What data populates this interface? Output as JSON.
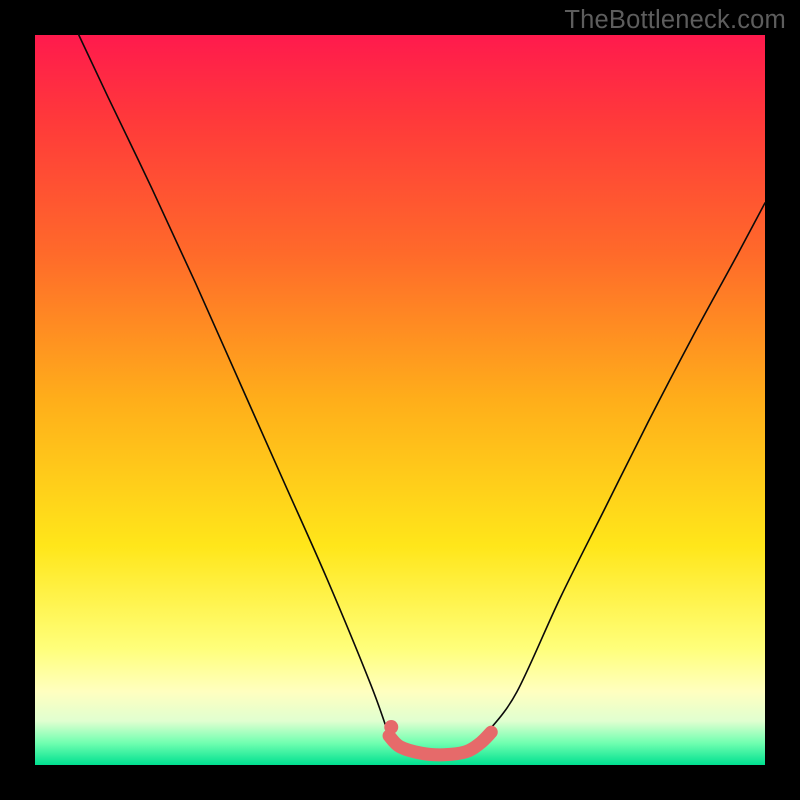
{
  "watermark": "TheBottleneck.com",
  "chart_data": {
    "type": "line",
    "title": "",
    "xlabel": "",
    "ylabel": "",
    "xlim": [
      0,
      100
    ],
    "ylim": [
      0,
      100
    ],
    "grid": false,
    "legend": false,
    "series": [
      {
        "name": "left-curve",
        "x": [
          6,
          10,
          16,
          22,
          28,
          34,
          40,
          46,
          48.5
        ],
        "values": [
          100,
          91.5,
          79,
          66,
          52.5,
          39,
          25.5,
          11,
          4
        ]
      },
      {
        "name": "right-curve",
        "x": [
          62,
          66,
          72,
          78,
          84,
          90,
          96,
          100
        ],
        "values": [
          4.5,
          10,
          23,
          35,
          47,
          58.5,
          69.5,
          77
        ]
      },
      {
        "name": "sweet-spot-band",
        "x": [
          48.5,
          50,
          53,
          56,
          59,
          61,
          62.5
        ],
        "values": [
          4,
          2.5,
          1.6,
          1.4,
          1.8,
          3,
          4.5
        ]
      }
    ],
    "annotations": [
      {
        "name": "sweet-spot-dot",
        "x": 48.8,
        "y": 5.2
      }
    ],
    "colors": {
      "curve": "#0a0a0a",
      "sweet_spot": "#e66a6a",
      "gradient_top": "#ff1a4d",
      "gradient_bottom": "#00e090",
      "frame": "#000000"
    }
  }
}
